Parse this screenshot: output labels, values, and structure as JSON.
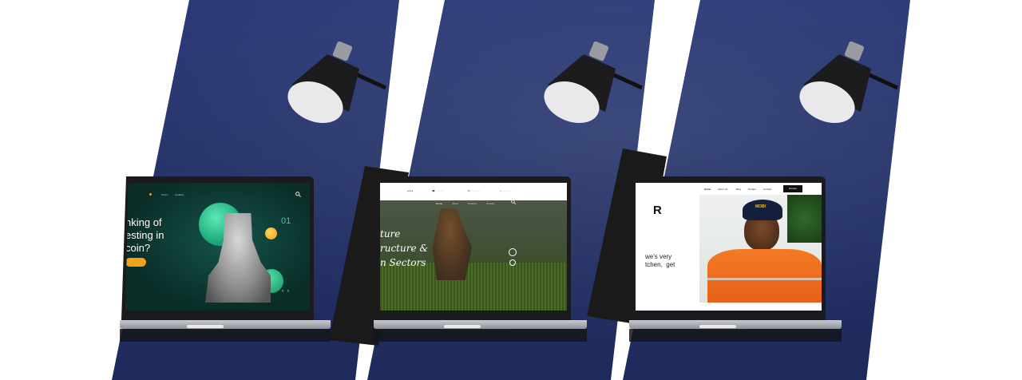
{
  "screens": {
    "s1": {
      "nav_items": [
        "Prices",
        "Updates",
        "",
        ""
      ],
      "headline": "nking of\nesting in\ncoin?",
      "counter": "01",
      "cta": "",
      "colors": {
        "bg": "#0e3a33",
        "accent": "#f0a21c",
        "orb": "#23c48e"
      }
    },
    "s2": {
      "nav_items": [
        "Home",
        "About",
        "Projects",
        "Contact"
      ],
      "headline": "ture\nructure &\nn Sectors",
      "colors": {
        "overlay": "#2f3d2a"
      }
    },
    "s3": {
      "nav_items": [
        "Home",
        "About Us",
        "Blog",
        "Donate",
        "Contact"
      ],
      "button": "Donate",
      "headline_letter": "R",
      "body": "we's very\ntchen,  get",
      "cap_text": "MOBI",
      "colors": {
        "vest": "#f26a1b"
      }
    }
  },
  "icons": [
    "desk-lamp-icon",
    "search-icon"
  ]
}
